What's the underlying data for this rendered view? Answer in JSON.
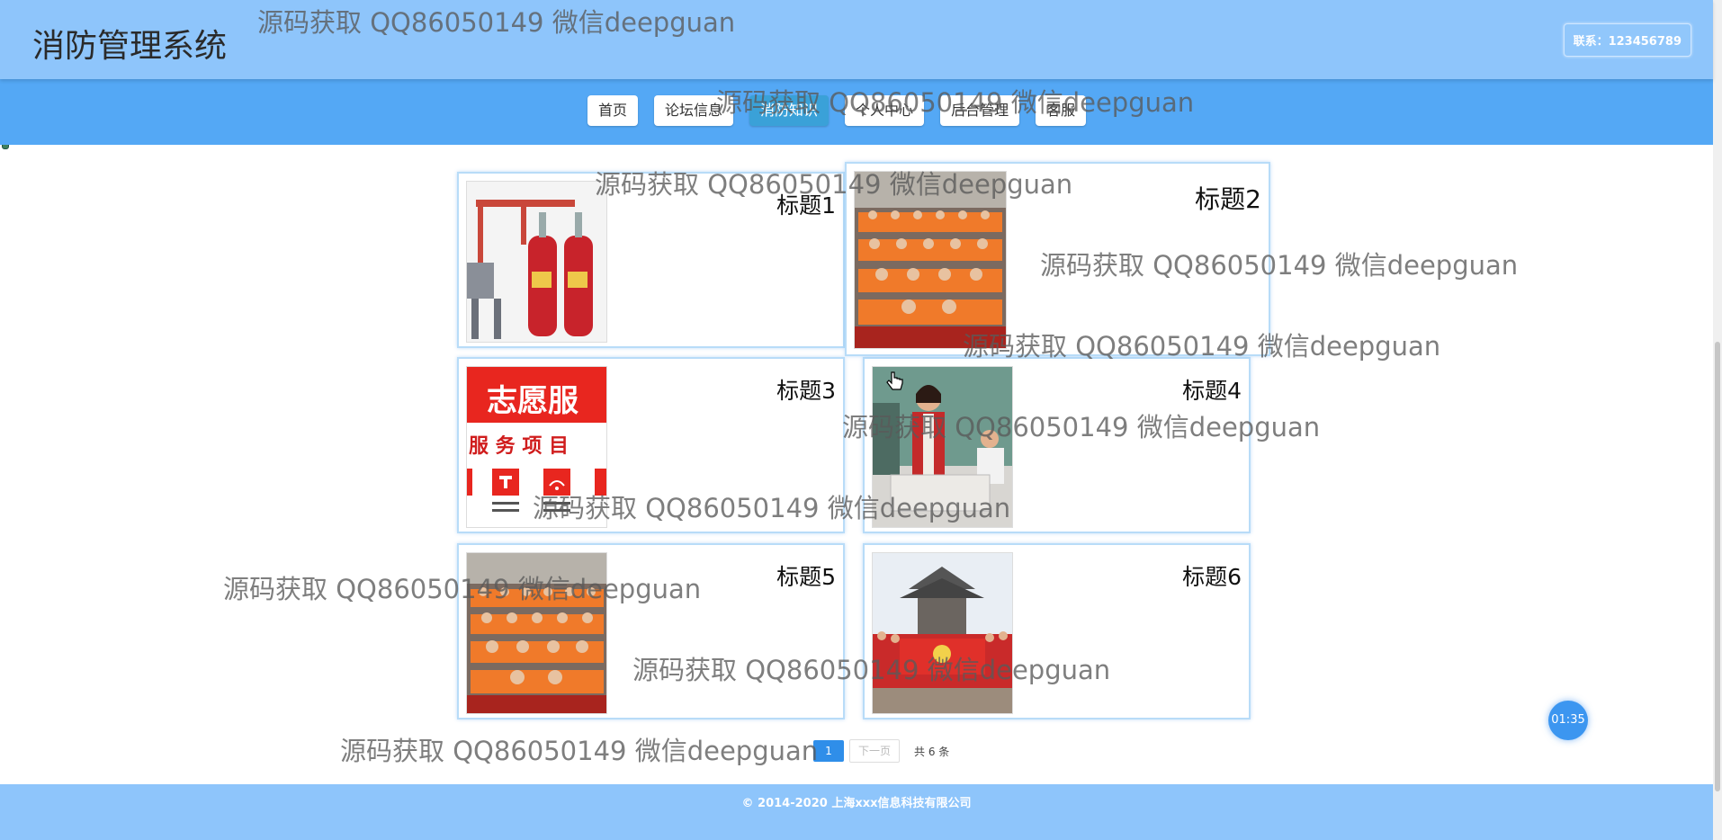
{
  "app": {
    "title": "消防管理系统",
    "contact": "联系：123456789"
  },
  "nav": {
    "items": [
      {
        "label": "首页"
      },
      {
        "label": "论坛信息"
      },
      {
        "label": "消防知识",
        "active": true
      },
      {
        "label": "个人中心"
      },
      {
        "label": "后台管理"
      },
      {
        "label": "客服"
      }
    ]
  },
  "cards": [
    {
      "title": "标题1",
      "image": "fire-extinguisher-cylinders-photo"
    },
    {
      "title": "标题2",
      "image": "audience-orange-shirts-photo"
    },
    {
      "title": "标题3",
      "image": "volunteer-service-poster",
      "poster_heading": "志愿服",
      "poster_sub": "服 务 项 目"
    },
    {
      "title": "标题4",
      "image": "woman-red-vest-table-photo"
    },
    {
      "title": "标题5",
      "image": "audience-orange-shirts-photo"
    },
    {
      "title": "标题6",
      "image": "group-red-banner-pavilion-photo"
    }
  ],
  "pagination": {
    "current": "1",
    "next": "下一页",
    "total": "共 6 条"
  },
  "footer": {
    "copyright": "© 2014-2020 上海xxx信息科技有限公司"
  },
  "timer": "01:35",
  "watermark": "源码获取 QQ86050149 微信deepguan",
  "colors": {
    "header": "#8ec5fb",
    "nav": "#54a8f5",
    "active_nav": "#3aa1d8",
    "page_accent": "#2f8ee9"
  }
}
